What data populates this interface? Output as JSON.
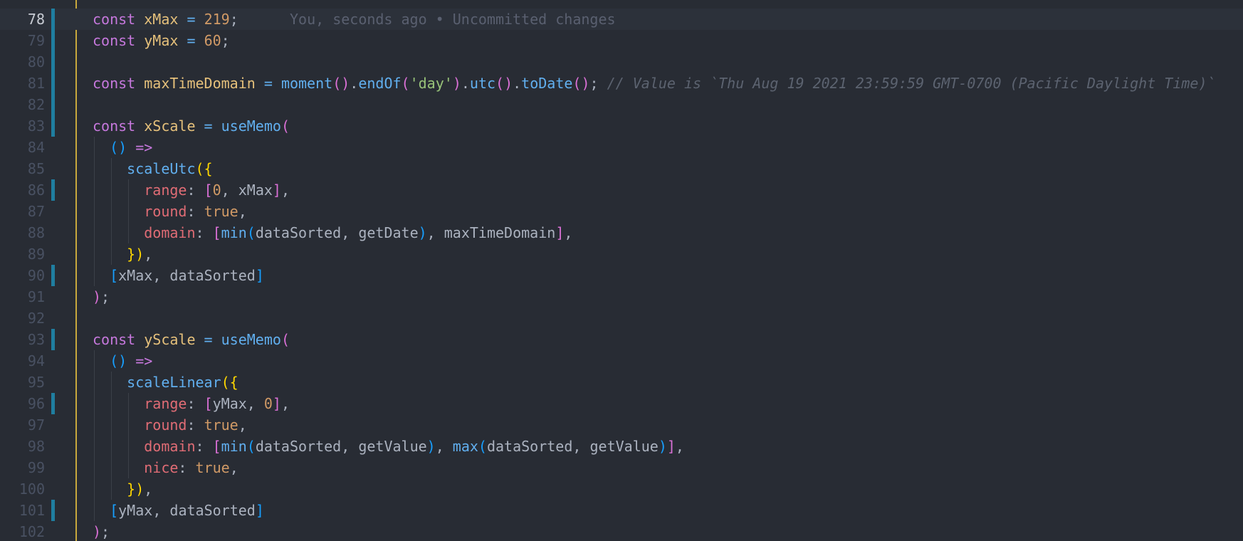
{
  "editor": {
    "language": "javascript",
    "theme_colors": {
      "background": "#282c34",
      "current_line": "#2c313a",
      "keyword": "#c678dd",
      "variable": "#e5c07b",
      "property": "#e06c75",
      "number": "#d19a66",
      "function": "#61afef",
      "string": "#98c379",
      "comment": "#5c6370",
      "change_marker": "#1f7ea0",
      "scope_guide": "#c8a93c"
    },
    "active_line": "78",
    "blame": "You, seconds ago • Uncommitted changes",
    "lines": [
      {
        "number": "78"
      },
      {
        "number": "79"
      },
      {
        "number": "80"
      },
      {
        "number": "81"
      },
      {
        "number": "82"
      },
      {
        "number": "83"
      },
      {
        "number": "84"
      },
      {
        "number": "85"
      },
      {
        "number": "86"
      },
      {
        "number": "87"
      },
      {
        "number": "88"
      },
      {
        "number": "89"
      },
      {
        "number": "90"
      },
      {
        "number": "91"
      },
      {
        "number": "92"
      },
      {
        "number": "93"
      },
      {
        "number": "94"
      },
      {
        "number": "95"
      },
      {
        "number": "96"
      },
      {
        "number": "97"
      },
      {
        "number": "98"
      },
      {
        "number": "99"
      },
      {
        "number": "100"
      },
      {
        "number": "101"
      },
      {
        "number": "102"
      }
    ],
    "tokens": {
      "kw_const": "const",
      "xMax": "xMax",
      "yMax": "yMax",
      "eq": " = ",
      "semi": ";",
      "n219": "219",
      "n60": "60",
      "n0": "0",
      "maxTimeDomain": "maxTimeDomain",
      "moment": "moment",
      "endOf": "endOf",
      "day": "'day'",
      "utc": "utc",
      "toDate": "toDate",
      "dot": ".",
      "comment81": "// Value is `Thu Aug 19 2021 23:59:59 GMT-0700 (Pacific Daylight Time)`",
      "xScale": "xScale",
      "yScale": "yScale",
      "useMemo": "useMemo",
      "arrow": "=>",
      "scaleUtc": "scaleUtc",
      "scaleLinear": "scaleLinear",
      "range": "range",
      "round": "round",
      "domain": "domain",
      "nice": "nice",
      "true": "true",
      "colon": ": ",
      "comma": ", ",
      "comma_end": ",",
      "min": "min",
      "max": "max",
      "dataSorted": "dataSorted",
      "getDate": "getDate",
      "getValue": "getValue"
    }
  }
}
